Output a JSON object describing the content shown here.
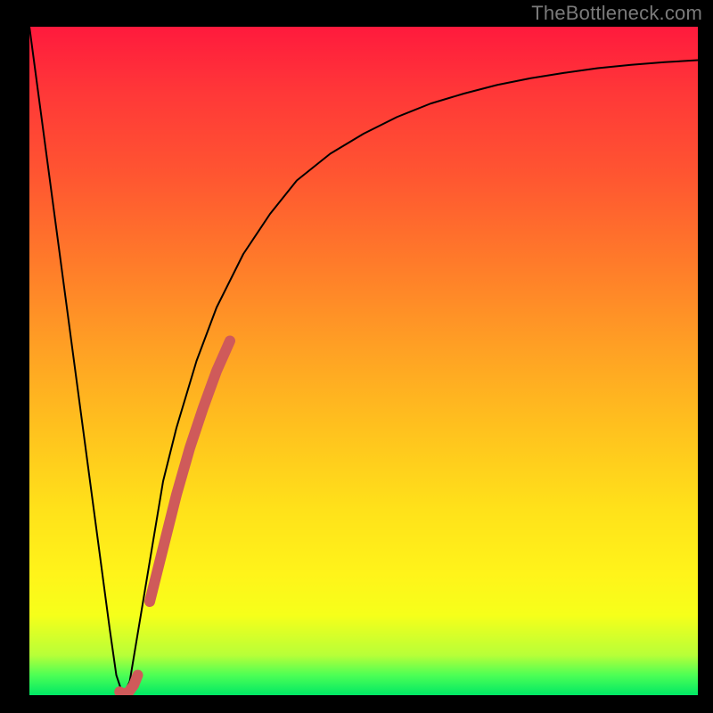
{
  "watermark": "TheBottleneck.com",
  "chart_data": {
    "type": "line",
    "title": "",
    "xlabel": "",
    "ylabel": "",
    "xlim": [
      0,
      100
    ],
    "ylim": [
      0,
      100
    ],
    "grid": false,
    "legend": false,
    "background_gradient": {
      "direction": "vertical",
      "stops": [
        {
          "pos": 0.0,
          "color": "#ff1a3d"
        },
        {
          "pos": 0.5,
          "color": "#ffa024"
        },
        {
          "pos": 0.82,
          "color": "#fff41a"
        },
        {
          "pos": 0.97,
          "color": "#4dff55"
        },
        {
          "pos": 1.0,
          "color": "#00e865"
        }
      ]
    },
    "series": [
      {
        "name": "bottleneck-curve",
        "color": "#000000",
        "stroke_width": 2,
        "x": [
          0,
          2,
          4,
          6,
          8,
          10,
          12,
          13,
          14,
          15,
          16,
          18,
          20,
          22,
          25,
          28,
          32,
          36,
          40,
          45,
          50,
          55,
          60,
          65,
          70,
          75,
          80,
          85,
          90,
          95,
          100
        ],
        "y": [
          100,
          85,
          70,
          55,
          40,
          25,
          10,
          3,
          0,
          2,
          8,
          20,
          32,
          40,
          50,
          58,
          66,
          72,
          77,
          81,
          84,
          86.5,
          88.5,
          90,
          91.3,
          92.3,
          93.1,
          93.8,
          94.3,
          94.7,
          95
        ]
      },
      {
        "name": "highlight-hook",
        "color": "#cf5a5a",
        "stroke_width": 12,
        "x": [
          13.5,
          14.0,
          14.8,
          15.6,
          16.2
        ],
        "y": [
          0.5,
          0.2,
          0.4,
          1.5,
          3.0
        ]
      },
      {
        "name": "highlight-segment",
        "color": "#cf5a5a",
        "stroke_width": 12,
        "x": [
          18.0,
          20.0,
          22.0,
          24.0,
          26.0,
          28.0,
          30.0
        ],
        "y": [
          14.0,
          22.0,
          30.0,
          37.0,
          43.0,
          48.5,
          53.0
        ]
      }
    ]
  }
}
